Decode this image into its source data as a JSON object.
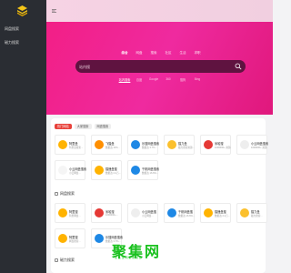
{
  "sidebar": {
    "items": [
      {
        "label": "网盘搜索"
      },
      {
        "label": "磁力搜索"
      }
    ]
  },
  "search": {
    "engines": [
      "综合",
      "网盘",
      "搜索",
      "社区",
      "生活",
      "求职"
    ],
    "active_engine": 0,
    "placeholder": "站内搜",
    "sub_tabs": [
      "站内搜索",
      "百度",
      "Google",
      "360",
      "搜狗",
      "Bing"
    ],
    "active_sub_tab": 0
  },
  "filters": {
    "chips": [
      "热门网站",
      "大家搜索",
      "网盘搜索"
    ],
    "active": 0
  },
  "grid1": [
    {
      "name": "阿里盘",
      "desc": "阿里盘搜索...",
      "color": "#ffb300",
      "icon": "alipan-icon"
    },
    {
      "name": "飞猫盘",
      "desc": "数据达 11%...",
      "color": "#ff8f00",
      "icon": "feimao-icon"
    },
    {
      "name": "乐搜网盘搜索",
      "desc": "数据达 3.7%...",
      "color": "#1e88e5",
      "icon": "k-icon"
    },
    {
      "name": "猫力盘",
      "desc": "磁力搜索资源...",
      "color": "#fbc02d",
      "icon": "maoli-icon"
    },
    {
      "name": "米哈搜",
      "desc": "1000000+ 资源...",
      "color": "#e53935",
      "icon": "k-red-icon"
    },
    {
      "name": "小云网盘搜索",
      "desc": "1000000+ 资源...",
      "color": "#eeeeee",
      "icon": "xiaoyun-icon"
    },
    {
      "name": "小云网盘搜索",
      "desc": "小云网盘...",
      "color": "#f5f5f5",
      "icon": "cloud-icon"
    },
    {
      "name": "猫狸盘搜",
      "desc": "数据达 2.4万...",
      "color": "#ffb300",
      "icon": "maoli2-icon"
    },
    {
      "name": "千帆网盘搜索",
      "desc": "数据达 16.6%...",
      "color": "#1e88e5",
      "icon": "k2-icon"
    }
  ],
  "section1": "网盘搜索",
  "grid2": [
    {
      "name": "阿里搜",
      "desc": "阿里网盘...",
      "color": "#ffb300",
      "icon": "ali-icon"
    },
    {
      "name": "米哈搜",
      "desc": "1000000+...",
      "color": "#e53935",
      "icon": "k3-icon"
    },
    {
      "name": "小云网盘搜",
      "desc": "小云网盘...",
      "color": "#eeeeee",
      "icon": "cloud2-icon"
    },
    {
      "name": "千帆网盘搜",
      "desc": "数据达 16.6%...",
      "color": "#1e88e5",
      "icon": "k4-icon"
    },
    {
      "name": "猫狸盘搜",
      "desc": "数据达 2.4万...",
      "color": "#ffb300",
      "icon": "maoli3-icon"
    },
    {
      "name": "猫力盘",
      "desc": "磁力搜索...",
      "color": "#fbc02d",
      "icon": "maoli4-icon"
    },
    {
      "name": "阿里搜",
      "desc": "网盘搜索...",
      "color": "#ffb300",
      "icon": "ali2-icon"
    },
    {
      "name": "乐搜网盘搜索",
      "desc": "数据达 3.7%...",
      "color": "#1e88e5",
      "icon": "k5-icon"
    }
  ],
  "section2": "磁力搜索",
  "watermark": {
    "text": "聚集网",
    "sub": "聚 集 全 网 优 质 资 源"
  }
}
